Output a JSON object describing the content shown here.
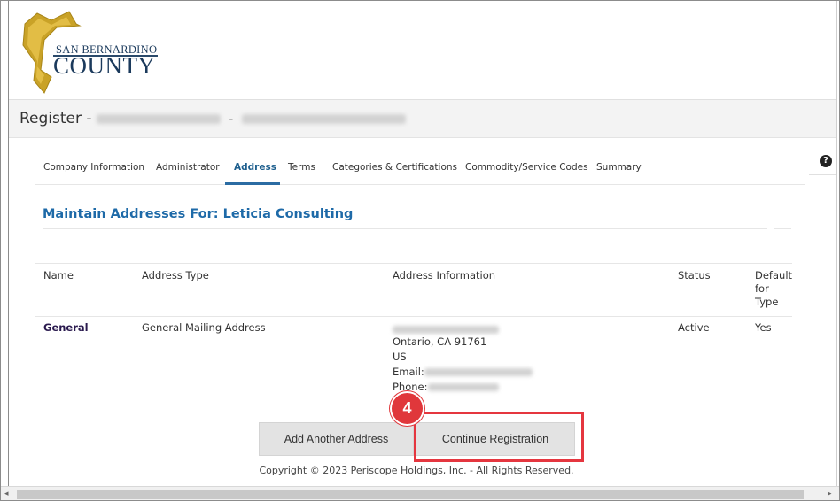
{
  "logo": {
    "line1": "SAN BERNARDINO",
    "line2": "COUNTY"
  },
  "page": {
    "title_prefix": "Register - ",
    "title_redacted_1": "leticia consulting",
    "title_redacted_2": "leticiacis@yahoo.com"
  },
  "help": {
    "glyph": "?"
  },
  "tabs": [
    {
      "label": "Company Information",
      "active": false
    },
    {
      "label": "Administrator",
      "active": false
    },
    {
      "label": "Address",
      "active": true
    },
    {
      "label": "Terms",
      "active": false
    },
    {
      "label": "Categories & Certifications",
      "active": false
    },
    {
      "label": "Commodity/Service Codes",
      "active": false
    },
    {
      "label": "Summary",
      "active": false
    }
  ],
  "section": {
    "title": "Maintain Addresses For: Leticia Consulting"
  },
  "table": {
    "headers": {
      "name": "Name",
      "address_type": "Address Type",
      "address_info": "Address Information",
      "status": "Status",
      "default_1": "Default",
      "default_2": "for",
      "default_3": "Type"
    },
    "rows": [
      {
        "name": "General",
        "address_type": "General Mailing Address",
        "address_street_redacted": "1025 S Hampton Way",
        "address_city": "Ontario, CA 91761",
        "address_country": "US",
        "email_label": "Email:",
        "email_redacted": "leticiacis@yahoo.com",
        "phone_label": "Phone:",
        "phone_redacted": "9095551234",
        "status": "Active",
        "default": "Yes"
      }
    ]
  },
  "buttons": {
    "add_another": "Add Another Address",
    "continue": "Continue Registration"
  },
  "annotation": {
    "step": "4",
    "color": "#e0373b"
  },
  "footer": {
    "copyright": "Copyright © 2023 Periscope Holdings, Inc. - All Rights Reserved."
  },
  "scrollbar": {
    "left_arrow": "◂",
    "right_arrow": "▸"
  }
}
